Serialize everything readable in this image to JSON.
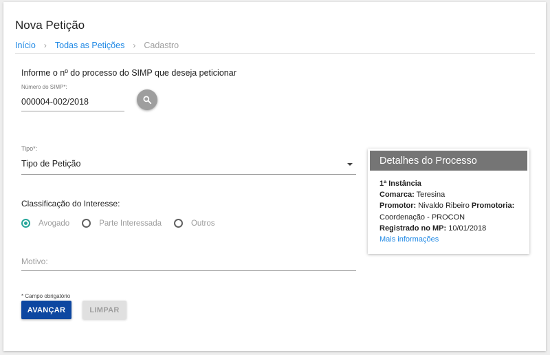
{
  "page": {
    "title": "Nova Petição",
    "breadcrumb": [
      "Início",
      "Todas as Petições",
      "Cadastro"
    ]
  },
  "form": {
    "intro": "Informe o nº do processo do SIMP que deseja peticionar",
    "simp_label": "Número do SIMP*:",
    "simp_value": "000004-002/2018",
    "tipo_label": "Tipo*:",
    "tipo_value": "Tipo de Petição",
    "classificacao_label": "Classificação do Interesse:",
    "radio_options": [
      "Avogado",
      "Parte Interessada",
      "Outros"
    ],
    "radio_selected": "Avogado",
    "motivo_placeholder": "Motivo:",
    "required_note": "* Campo obrigatório",
    "advance_button": "AVANÇAR",
    "clear_button": "LIMPAR"
  },
  "details": {
    "title": "Detalhes do Processo",
    "instancia": "1ª Instância",
    "comarca_label": "Comarca:",
    "comarca_value": "Teresina",
    "promotor_label": "Promotor:",
    "promotor_value": "Nivaldo Ribeiro",
    "promotoria_label": "Promotoria:",
    "promotoria_value": "Coordenação - PROCON",
    "registrado_label": "Registrado no MP:",
    "registrado_value": "10/01/2018",
    "more_link": "Mais informações"
  },
  "colors": {
    "accent": "#1e88e5",
    "primary_button": "#0d47a1",
    "radio_checked": "#26a69a",
    "details_header": "#757575"
  },
  "icons": {
    "search": "search-icon",
    "dropdown": "caret-down-icon",
    "breadcrumb_separator": "chevron-right-icon"
  }
}
